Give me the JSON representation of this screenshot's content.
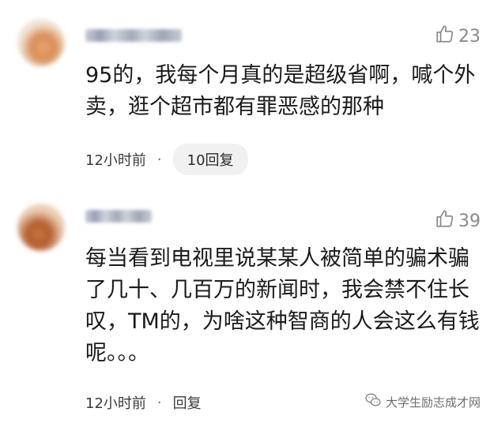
{
  "comments": [
    {
      "likes": "23",
      "text": "95的，我每个月真的是超级省啊，喊个外卖，逛个超市都有罪恶感的那种",
      "time": "12小时前",
      "separator": "·",
      "reply_label": "10回复"
    },
    {
      "likes": "39",
      "text": "每当看到电视里说某某人被简单的骗术骗了几十、几百万的新闻时，我会禁不住长叹，TM的，为啥这种智商的人会这么有钱呢。。。",
      "time": "12小时前",
      "separator": "·",
      "reply_label": "回复"
    }
  ],
  "watermark": {
    "text": "大学生励志成才网",
    "icon": "wechat-icon"
  },
  "icons": {
    "like": "thumbs-up-icon"
  }
}
